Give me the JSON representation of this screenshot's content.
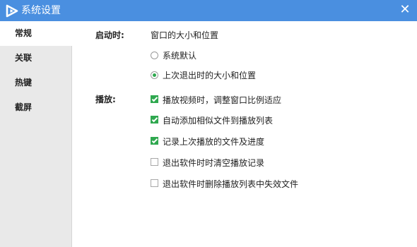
{
  "window": {
    "title": "系统设置",
    "close_glyph": "✕",
    "logo_icon": "play-logo-icon",
    "accent": "#4a8fe0"
  },
  "sidebar": {
    "items": [
      {
        "label": "常规",
        "active": true
      },
      {
        "label": "关联",
        "active": false
      },
      {
        "label": "热键",
        "active": false
      },
      {
        "label": "截屏",
        "active": false
      }
    ]
  },
  "startup": {
    "label": "启动时:",
    "heading": "窗口的大小和位置",
    "options": [
      {
        "label": "系统默认",
        "selected": false
      },
      {
        "label": "上次退出时的大小和位置",
        "selected": true
      }
    ]
  },
  "playback": {
    "label": "播放:",
    "options": [
      {
        "label": "播放视频时，调整窗口比例适应",
        "checked": true
      },
      {
        "label": "自动添加相似文件到播放列表",
        "checked": true
      },
      {
        "label": "记录上次播放的文件及进度",
        "checked": true
      },
      {
        "label": "退出软件时时清空播放记录",
        "checked": false
      },
      {
        "label": "退出软件时删除播放列表中失效文件",
        "checked": false
      }
    ]
  },
  "colors": {
    "check_green": "#2fa84f"
  }
}
